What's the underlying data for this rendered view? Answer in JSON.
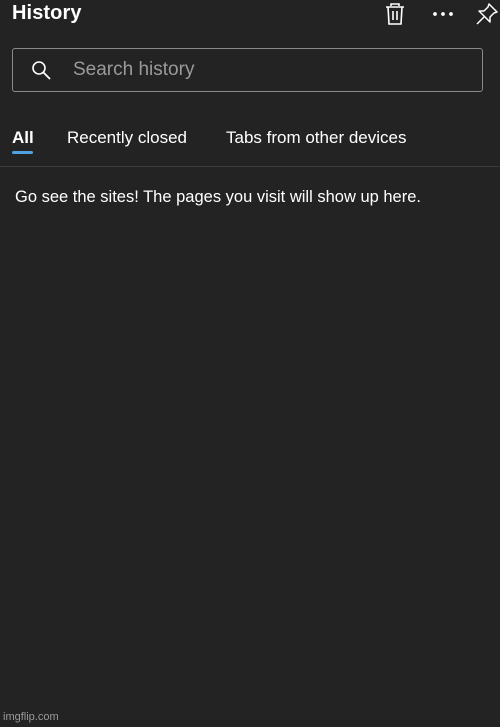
{
  "header": {
    "title": "History",
    "delete_icon": "trash-icon",
    "more_icon": "more-icon",
    "pin_icon": "pin-icon"
  },
  "search": {
    "placeholder": "Search history",
    "value": "",
    "icon": "search-icon"
  },
  "tabs": [
    {
      "label": "All",
      "active": true
    },
    {
      "label": "Recently closed",
      "active": false
    },
    {
      "label": "Tabs from other devices",
      "active": false
    }
  ],
  "main": {
    "empty_message": "Go see the sites! The pages you visit will show up here."
  },
  "watermark": "imgflip.com",
  "colors": {
    "background": "#232323",
    "accent": "#4fa3e0",
    "text": "#ffffff",
    "placeholder": "#9a9a9a",
    "border": "#8a8a8a"
  }
}
